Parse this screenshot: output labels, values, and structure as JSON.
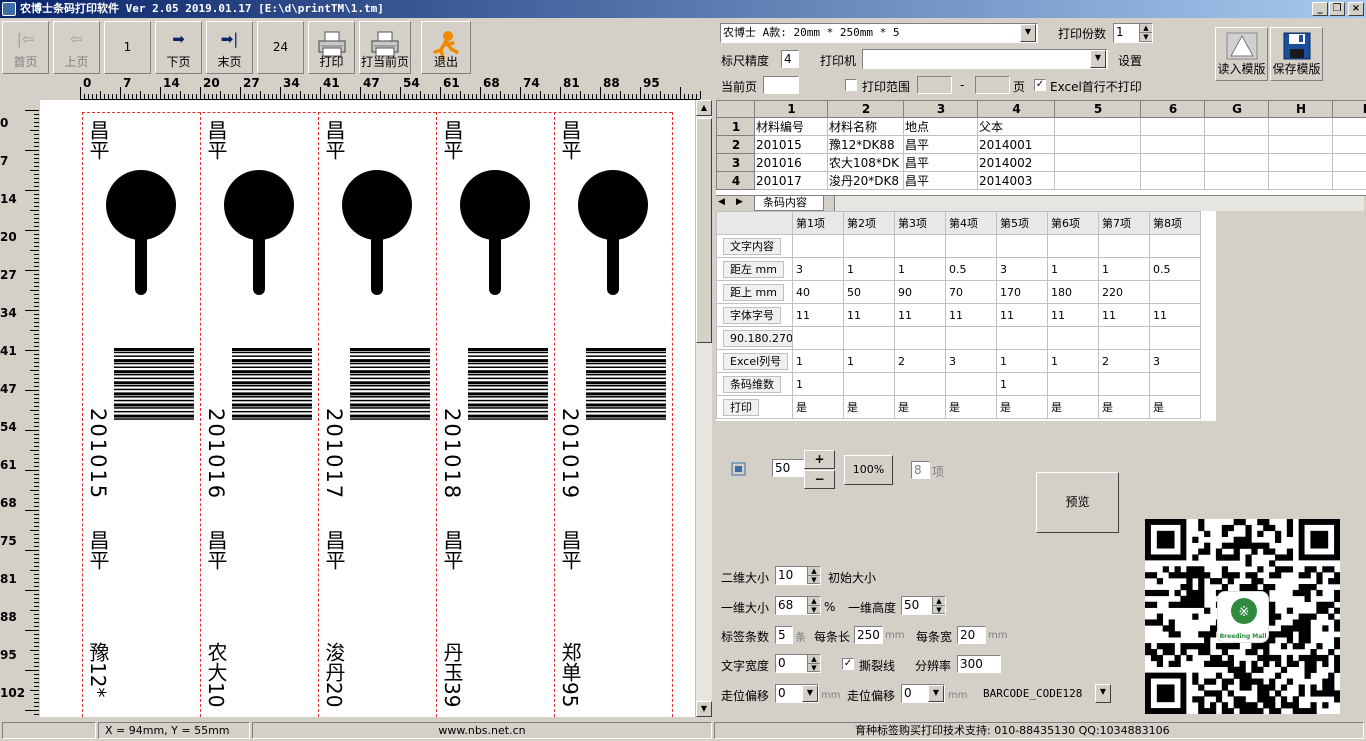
{
  "window": {
    "title": "农博士条码打印软件 Ver 2.05 2019.01.17 [E:\\d\\printTM\\1.tm]"
  },
  "toolbar": {
    "first": "首页",
    "prev": "上页",
    "page_current": "1",
    "next": "下页",
    "last": "末页",
    "page_total": "24",
    "print": "打印",
    "print_current": "打当前页",
    "exit": "退出",
    "load_template": "读入模版",
    "save_template": "保存模版"
  },
  "top_settings": {
    "label_type": "农博士 A款: 20mm * 250mm * 5",
    "copies_label": "打印份数",
    "copies": "1",
    "ruler_label": "标尺精度",
    "ruler": "4",
    "printer_label": "打印机",
    "printer": "",
    "setup_label": "设置",
    "current_page_label": "当前页",
    "current_page": "",
    "range_label": "打印范围",
    "range_from": "",
    "range_dash": "-",
    "range_to": "",
    "range_unit": "页",
    "excel_first_row_label": "Excel首行不打印"
  },
  "sheet": {
    "col_headers": [
      "1",
      "2",
      "3",
      "4",
      "5",
      "6",
      "G",
      "H",
      "I"
    ],
    "rows": [
      {
        "n": "1",
        "cells": [
          "材料编号",
          "材料名称",
          "地点",
          "父本",
          "",
          "",
          "",
          ""
        ]
      },
      {
        "n": "2",
        "cells": [
          "201015",
          "豫12*DK88",
          "昌平",
          "2014001",
          "",
          "",
          "",
          ""
        ]
      },
      {
        "n": "3",
        "cells": [
          "201016",
          "农大108*DK",
          "昌平",
          "2014002",
          "",
          "",
          "",
          ""
        ]
      },
      {
        "n": "4",
        "cells": [
          "201017",
          "浚丹20*DK8",
          "昌平",
          "2014003",
          "",
          "",
          "",
          ""
        ]
      }
    ],
    "sheet_tab": "条码内容"
  },
  "items_grid": {
    "headers": [
      "第1项",
      "第2项",
      "第3项",
      "第4项",
      "第5项",
      "第6项",
      "第7项",
      "第8项"
    ],
    "rows": [
      {
        "label": "文字内容",
        "cells": [
          "",
          "",
          "",
          "",
          "",
          "",
          "",
          ""
        ]
      },
      {
        "label": "距左 mm",
        "cells": [
          "3",
          "1",
          "1",
          "0.5",
          "3",
          "1",
          "1",
          "0.5"
        ]
      },
      {
        "label": "距上 mm",
        "cells": [
          "40",
          "50",
          "90",
          "70",
          "170",
          "180",
          "220",
          ""
        ]
      },
      {
        "label": "字体字号",
        "cells": [
          "11",
          "11",
          "11",
          "11",
          "11",
          "11",
          "11",
          "11"
        ]
      },
      {
        "label": "90.180.270",
        "cells": [
          "",
          "",
          "",
          "",
          "",
          "",
          "",
          ""
        ]
      },
      {
        "label": "Excel列号",
        "cells": [
          "1",
          "1",
          "2",
          "3",
          "1",
          "1",
          "2",
          "3"
        ]
      },
      {
        "label": "条码维数",
        "cells": [
          "1",
          "",
          "",
          "",
          "1",
          "",
          "",
          ""
        ]
      },
      {
        "label": "打印",
        "cells": [
          "是",
          "是",
          "是",
          "是",
          "是",
          "是",
          "是",
          "是"
        ]
      }
    ]
  },
  "zoom": {
    "value": "50",
    "plus": "+",
    "minus": "−",
    "reset": "100%",
    "items": "8",
    "items_unit": "项"
  },
  "preview_button": "预览",
  "options": {
    "qr_size_label": "二维大小",
    "qr_size": "10",
    "initial_size": "初始大小",
    "bar_size_label": "一维大小",
    "bar_size": "68",
    "percent": "%",
    "bar_height_label": "一维高度",
    "bar_height": "50",
    "label_count_label": "标签条数",
    "label_count": "5",
    "label_count_unit": "条",
    "label_length_label": "每条长",
    "label_length": "250",
    "label_length_unit": "mm",
    "label_width_label": "每条宽",
    "label_width": "20",
    "label_width_unit": "mm",
    "text_width_label": "文字宽度",
    "text_width": "0",
    "tear_line_label": "撕裂线",
    "dpi_label": "分辨率",
    "dpi": "300",
    "offset1_label": "走位偏移",
    "offset1": "0",
    "offset1_unit": "mm",
    "offset2_label": "走位偏移",
    "offset2": "0",
    "offset2_unit": "mm",
    "barcode_type": "BARCODE_CODE128"
  },
  "qr": {
    "logo_text": "Breeding Mall"
  },
  "labels": [
    {
      "place": "昌平",
      "code": "201015",
      "name": "豫12*"
    },
    {
      "place": "昌平",
      "code": "201016",
      "name": "农大10"
    },
    {
      "place": "昌平",
      "code": "201017",
      "name": "浚丹20"
    },
    {
      "place": "昌平",
      "code": "201018",
      "name": "丹玉39"
    },
    {
      "place": "昌平",
      "code": "201019",
      "name": "郑单95"
    }
  ],
  "ruler_top": [
    "0",
    "7",
    "14",
    "20",
    "27",
    "34",
    "41",
    "47",
    "54",
    "61",
    "68",
    "74",
    "81",
    "88",
    "95"
  ],
  "ruler_left": [
    "0",
    "7",
    "14",
    "20",
    "27",
    "34",
    "41",
    "47",
    "54",
    "61",
    "68",
    "75",
    "81",
    "88",
    "95",
    "102"
  ],
  "status": {
    "coords": "X = 94mm, Y = 55mm",
    "website": "www.nbs.net.cn",
    "support": "育种标签购买打印技术支持:   010-88435130    QQ:1034883106"
  },
  "colors": {
    "titlebar": "#0a246a",
    "face": "#d4d0c8",
    "dash": "#e03030"
  }
}
